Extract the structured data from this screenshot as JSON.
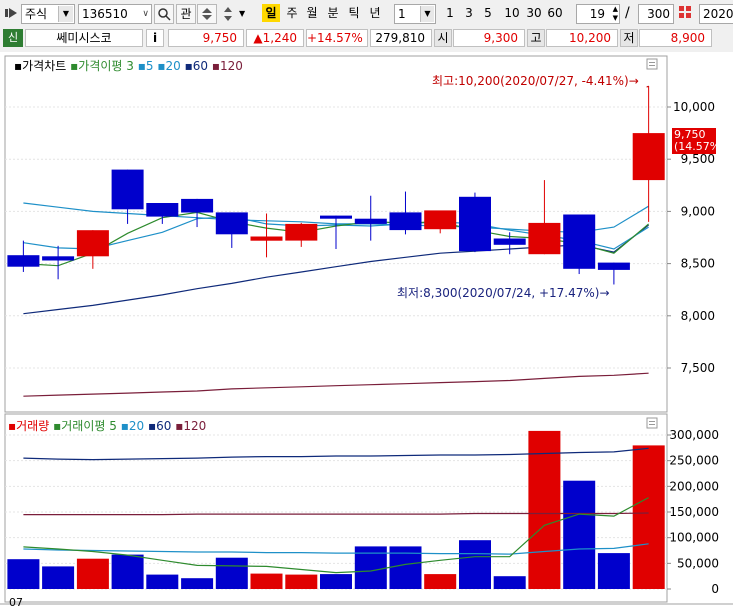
{
  "toolbar": {
    "market": "주식",
    "code": "136510",
    "btn_gwan": "관",
    "periods": [
      "일",
      "주",
      "월",
      "분",
      "틱",
      "년"
    ],
    "period_sel": "1",
    "ranges": [
      "1",
      "3",
      "5",
      "10",
      "30",
      "60"
    ],
    "count": "19",
    "slash": "/",
    "total": "300",
    "date": "2020/"
  },
  "quote": {
    "badge": "신",
    "name": "쎄미시스코",
    "info": "i",
    "price": "9,750",
    "change": "▲1,240",
    "rate": "+14.57%",
    "volume": "279,810",
    "open_label": "시",
    "open": "9,300",
    "high_label": "고",
    "high": "10,200",
    "low_label": "저",
    "low": "8,900"
  },
  "price_panel": {
    "legend_title": "가격차트",
    "legend_ma": "가격이평",
    "legend_periods": [
      "3",
      "5",
      "20",
      "60",
      "120"
    ],
    "y_ticks": [
      "10,000",
      "9,500",
      "9,000",
      "8,500",
      "8,000",
      "7,500"
    ],
    "current_price": "9,750",
    "current_rate": "(14.57%)",
    "max_note": "최고:10,200(2020/07/27, -4.41%)",
    "min_note": "최저:8,300(2020/07/24, +17.47%)"
  },
  "volume_panel": {
    "legend_title": "거래량",
    "legend_ma": "거래이평",
    "legend_periods": [
      "5",
      "20",
      "60",
      "120"
    ],
    "y_ticks": [
      "300,000",
      "250,000",
      "200,000",
      "150,000",
      "100,000",
      "50,000",
      "0"
    ]
  },
  "x_axis": {
    "month_label": "07"
  },
  "colors": {
    "up": "#e00000",
    "down": "#0000cc",
    "ma3": "#2e8b2e",
    "ma5": "#1e90c8",
    "ma20": "#1e3a8a",
    "ma60": "#0f2a7a",
    "ma120": "#7a1e3a",
    "accent": "#ffd800"
  },
  "chart_data": {
    "type": "candlestick",
    "candles": [
      {
        "o": 8580,
        "h": 8720,
        "l": 8420,
        "c": 8470
      },
      {
        "o": 8570,
        "h": 8670,
        "l": 8350,
        "c": 8530
      },
      {
        "o": 8570,
        "h": 8820,
        "l": 8450,
        "c": 8820
      },
      {
        "o": 9400,
        "h": 9400,
        "l": 8880,
        "c": 9020
      },
      {
        "o": 9080,
        "h": 9080,
        "l": 8880,
        "c": 8950
      },
      {
        "o": 9120,
        "h": 9120,
        "l": 8850,
        "c": 8990
      },
      {
        "o": 8990,
        "h": 8990,
        "l": 8650,
        "c": 8780
      },
      {
        "o": 8720,
        "h": 8980,
        "l": 8560,
        "c": 8760
      },
      {
        "o": 8720,
        "h": 8890,
        "l": 8660,
        "c": 8880
      },
      {
        "o": 8960,
        "h": 8960,
        "l": 8640,
        "c": 8930
      },
      {
        "o": 8930,
        "h": 9150,
        "l": 8720,
        "c": 8880
      },
      {
        "o": 8990,
        "h": 9190,
        "l": 8780,
        "c": 8820
      },
      {
        "o": 8830,
        "h": 9000,
        "l": 8790,
        "c": 9010
      },
      {
        "o": 9140,
        "h": 9180,
        "l": 8610,
        "c": 8620
      },
      {
        "o": 8740,
        "h": 8800,
        "l": 8590,
        "c": 8680
      },
      {
        "o": 8590,
        "h": 9300,
        "l": 8590,
        "c": 8890
      },
      {
        "o": 8970,
        "h": 8970,
        "l": 8400,
        "c": 8450
      },
      {
        "o": 8510,
        "h": 8510,
        "l": 8300,
        "c": 8440
      },
      {
        "o": 9300,
        "h": 10200,
        "l": 8900,
        "c": 9750
      }
    ],
    "volume": [
      58000,
      44000,
      59000,
      67000,
      28000,
      21000,
      61000,
      30000,
      28000,
      29000,
      83000,
      83000,
      29000,
      95000,
      25000,
      308000,
      211000,
      70000,
      279810
    ],
    "ma_price": {
      "ma3": [
        8500,
        8480,
        8600,
        8790,
        8940,
        8990,
        8900,
        8840,
        8800,
        8860,
        8900,
        8890,
        8900,
        8820,
        8760,
        8740,
        8690,
        8600,
        8880
      ],
      "ma5": [
        8700,
        8650,
        8640,
        8720,
        8800,
        8930,
        8950,
        8880,
        8860,
        8870,
        8860,
        8880,
        8900,
        8880,
        8820,
        8770,
        8720,
        8640,
        8850
      ],
      "ma20": [
        9080,
        9040,
        9000,
        8980,
        8960,
        8940,
        8920,
        8910,
        8900,
        8880,
        8880,
        8870,
        8860,
        8850,
        8830,
        8810,
        8800,
        8850,
        9050
      ],
      "ma60": [
        8020,
        8060,
        8100,
        8150,
        8200,
        8260,
        8310,
        8370,
        8420,
        8470,
        8520,
        8560,
        8600,
        8620,
        8640,
        8660,
        8680,
        8610,
        8870
      ],
      "ma120": [
        7230,
        7240,
        7250,
        7260,
        7270,
        7280,
        7300,
        7310,
        7320,
        7330,
        7340,
        7350,
        7360,
        7370,
        7380,
        7400,
        7420,
        7430,
        7450
      ]
    },
    "ma_volume": {
      "ma5": [
        82000,
        78000,
        73000,
        66000,
        56000,
        46000,
        45000,
        44000,
        38000,
        32000,
        35000,
        48000,
        56000,
        63000,
        63000,
        124000,
        146000,
        142000,
        178000
      ],
      "ma20": [
        78000,
        76000,
        75000,
        74000,
        73000,
        72000,
        72000,
        71000,
        71000,
        70000,
        70000,
        70000,
        69000,
        69000,
        68000,
        73000,
        78000,
        79000,
        88000
      ],
      "ma60": [
        255000,
        253000,
        252000,
        253000,
        254000,
        255000,
        257000,
        258000,
        258000,
        259000,
        259000,
        260000,
        261000,
        261000,
        262000,
        264000,
        266000,
        267000,
        274000
      ],
      "ma120": [
        145000,
        145000,
        145000,
        145000,
        145000,
        146000,
        146000,
        146000,
        146000,
        146000,
        146000,
        146000,
        146000,
        147000,
        147000,
        147000,
        147000,
        147000,
        148000
      ]
    },
    "ylim_price": [
      7300,
      10400
    ],
    "ylim_volume": [
      0,
      320000
    ],
    "legend": "top-left"
  }
}
